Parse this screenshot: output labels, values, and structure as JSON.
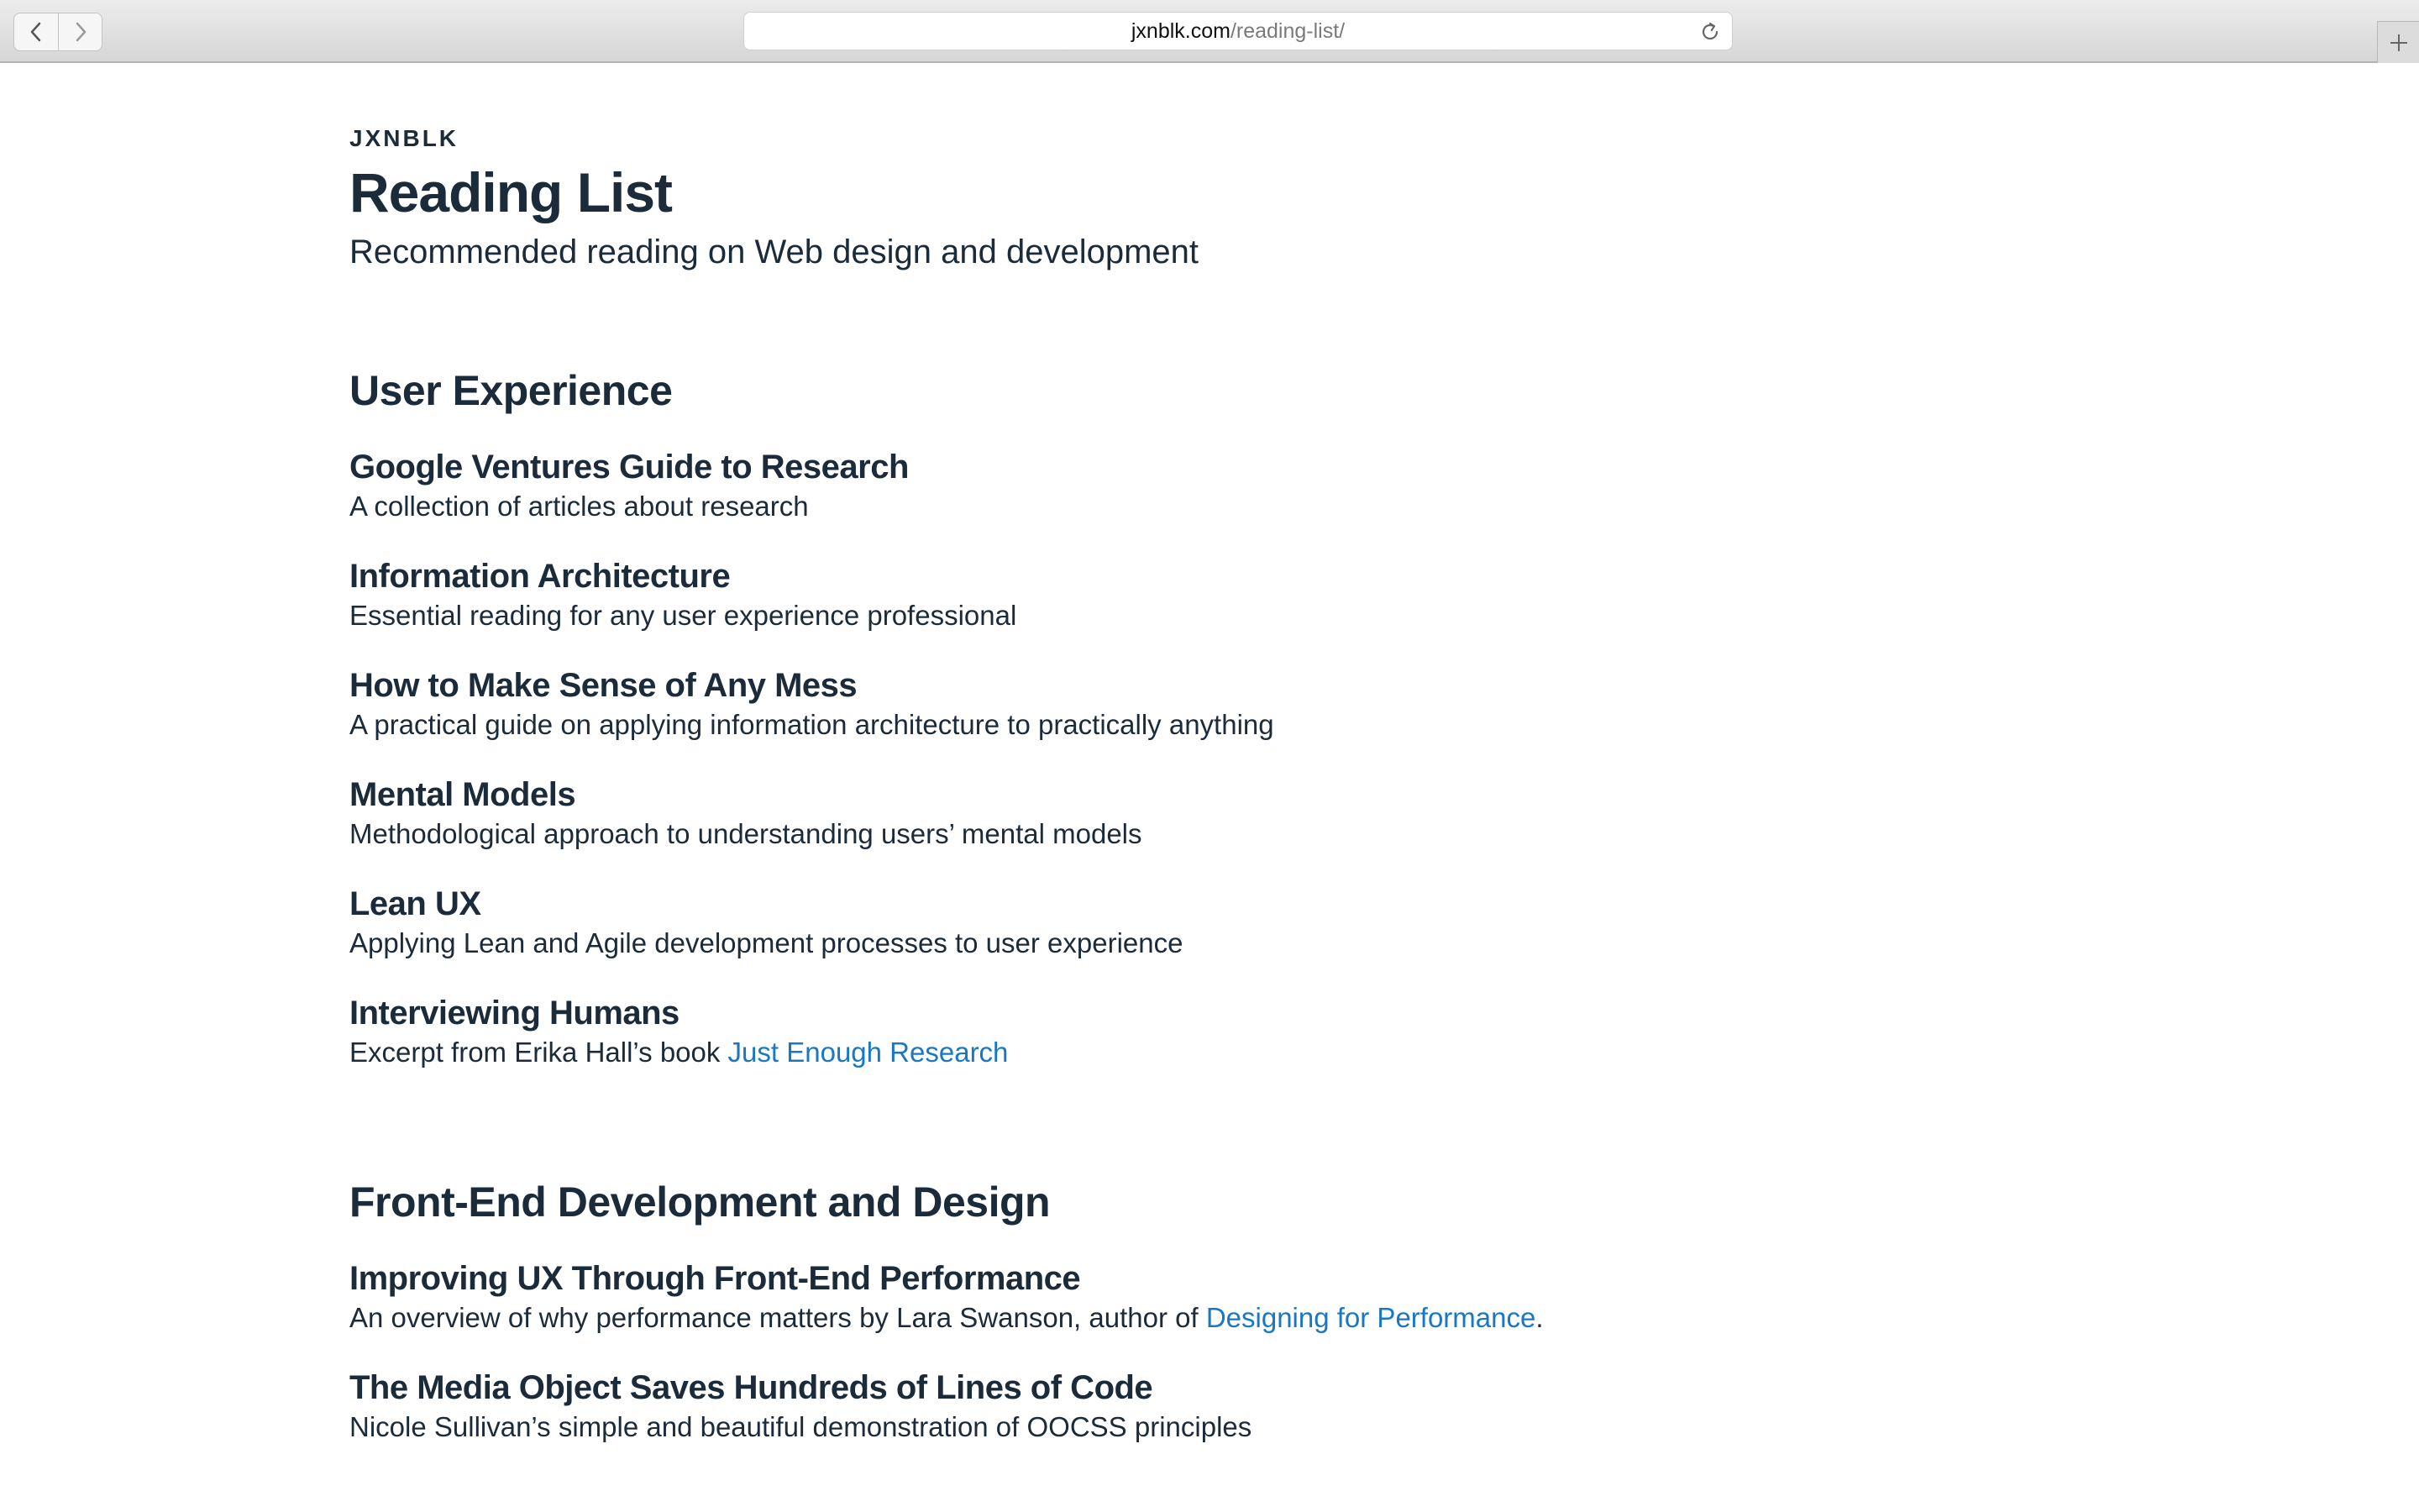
{
  "browser": {
    "url_domain": "jxnblk.com",
    "url_path": "/reading-list/",
    "icons": {
      "back": "chevron-left-icon",
      "forward": "chevron-right-icon",
      "reload": "reload-icon",
      "new_tab": "plus-icon"
    }
  },
  "header": {
    "site_name": "JXNBLK",
    "title": "Reading List",
    "subtitle": "Recommended reading on Web design and development"
  },
  "colors": {
    "text": "#1c2b3a",
    "link": "#1a78c2"
  },
  "sections": [
    {
      "title": "User Experience",
      "entries": [
        {
          "title": "Google Ventures Guide to Research",
          "desc": "A collection of articles about research"
        },
        {
          "title": "Information Architecture",
          "desc": "Essential reading for any user experience professional"
        },
        {
          "title": "How to Make Sense of Any Mess",
          "desc": "A practical guide on applying information architecture to practically anything"
        },
        {
          "title": "Mental Models",
          "desc": "Methodological approach to understanding users’ mental models"
        },
        {
          "title": "Lean UX",
          "desc": "Applying Lean and Agile development processes to user experience"
        },
        {
          "title": "Interviewing Humans",
          "desc_before": "Excerpt from Erika Hall’s book ",
          "link": "Just Enough Research",
          "desc_after": ""
        }
      ]
    },
    {
      "title": "Front-End Development and Design",
      "entries": [
        {
          "title": "Improving UX Through Front-End Performance",
          "desc_before": "An overview of why performance matters by Lara Swanson, author of ",
          "link": "Designing for Performance",
          "desc_after": "."
        },
        {
          "title": "The Media Object Saves Hundreds of Lines of Code",
          "desc": "Nicole Sullivan’s simple and beautiful demonstration of OOCSS principles"
        }
      ]
    }
  ]
}
